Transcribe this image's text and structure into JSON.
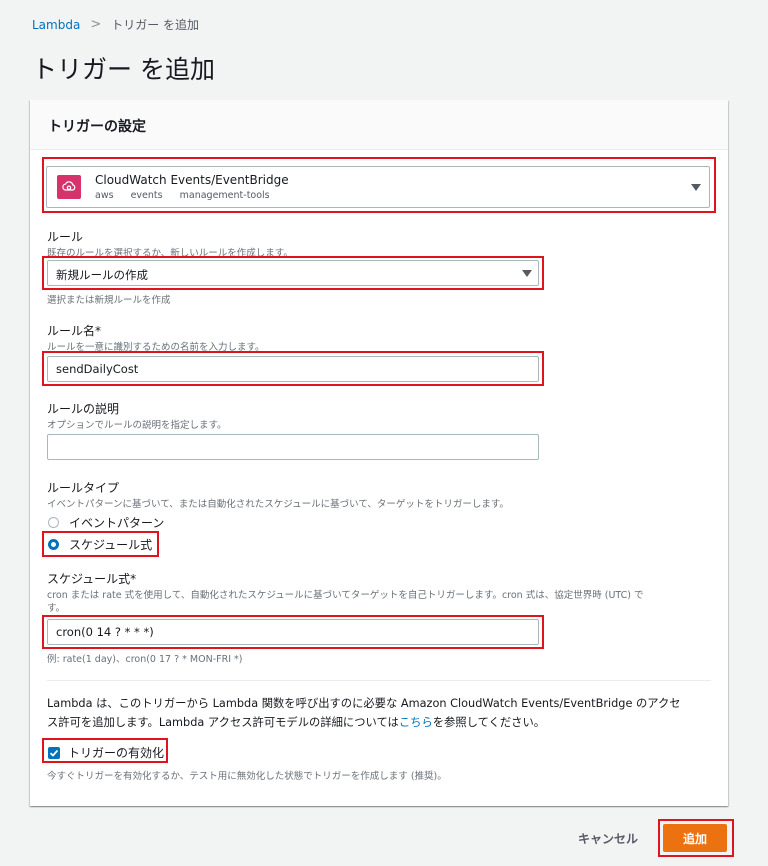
{
  "breadcrumb": {
    "root": "Lambda",
    "current": "トリガー を追加"
  },
  "page_title": "トリガー を追加",
  "panel": {
    "title": "トリガーの設定",
    "trigger": {
      "name": "CloudWatch Events/EventBridge",
      "tags": [
        "aws",
        "events",
        "management-tools"
      ],
      "icon": "cloudwatch-events-icon",
      "icon_color": "#d6336c"
    },
    "rule": {
      "label": "ルール",
      "desc": "既存のルールを選択するか、新しいルールを作成します。",
      "selected": "新規ルールの作成",
      "hint": "選択または新規ルールを作成"
    },
    "rule_name": {
      "label": "ルール名*",
      "desc": "ルールを一意に識別するための名前を入力します。",
      "value": "sendDailyCost"
    },
    "rule_description": {
      "label": "ルールの説明",
      "desc": "オプションでルールの説明を指定します。",
      "value": ""
    },
    "rule_type": {
      "label": "ルールタイプ",
      "desc": "イベントパターンに基づいて、または自動化されたスケジュールに基づいて、ターゲットをトリガーします。",
      "options": [
        "イベントパターン",
        "スケジュール式"
      ],
      "selected": "スケジュール式"
    },
    "schedule": {
      "label": "スケジュール式*",
      "desc_line1": "cron または rate 式を使用して、自動化されたスケジュールに基づいてターゲットを自己トリガーします。cron 式は、協定世界時 (UTC) で",
      "desc_line2": "す。",
      "value": "cron(0 14 ? * * *)",
      "example": "例: rate(1 day)、cron(0 17 ? * MON-FRI *)"
    },
    "info": {
      "text_line1": "Lambda は、このトリガーから Lambda 関数を呼び出すのに必要な Amazon CloudWatch Events/EventBridge のアクセ",
      "text_line2_pre": "ス許可を追加します。Lambda アクセス許可モデルの詳細については",
      "link": "こちら",
      "text_line2_post": "を参照してください。"
    },
    "enable": {
      "label": "トリガーの有効化",
      "checked": true,
      "desc": "今すぐトリガーを有効化するか、テスト用に無効化した状態でトリガーを作成します (推奨)。"
    }
  },
  "actions": {
    "cancel": "キャンセル",
    "add": "追加"
  },
  "colors": {
    "accent": "#0073bb",
    "primary_button": "#ec7211",
    "highlight": "#e0141e"
  }
}
